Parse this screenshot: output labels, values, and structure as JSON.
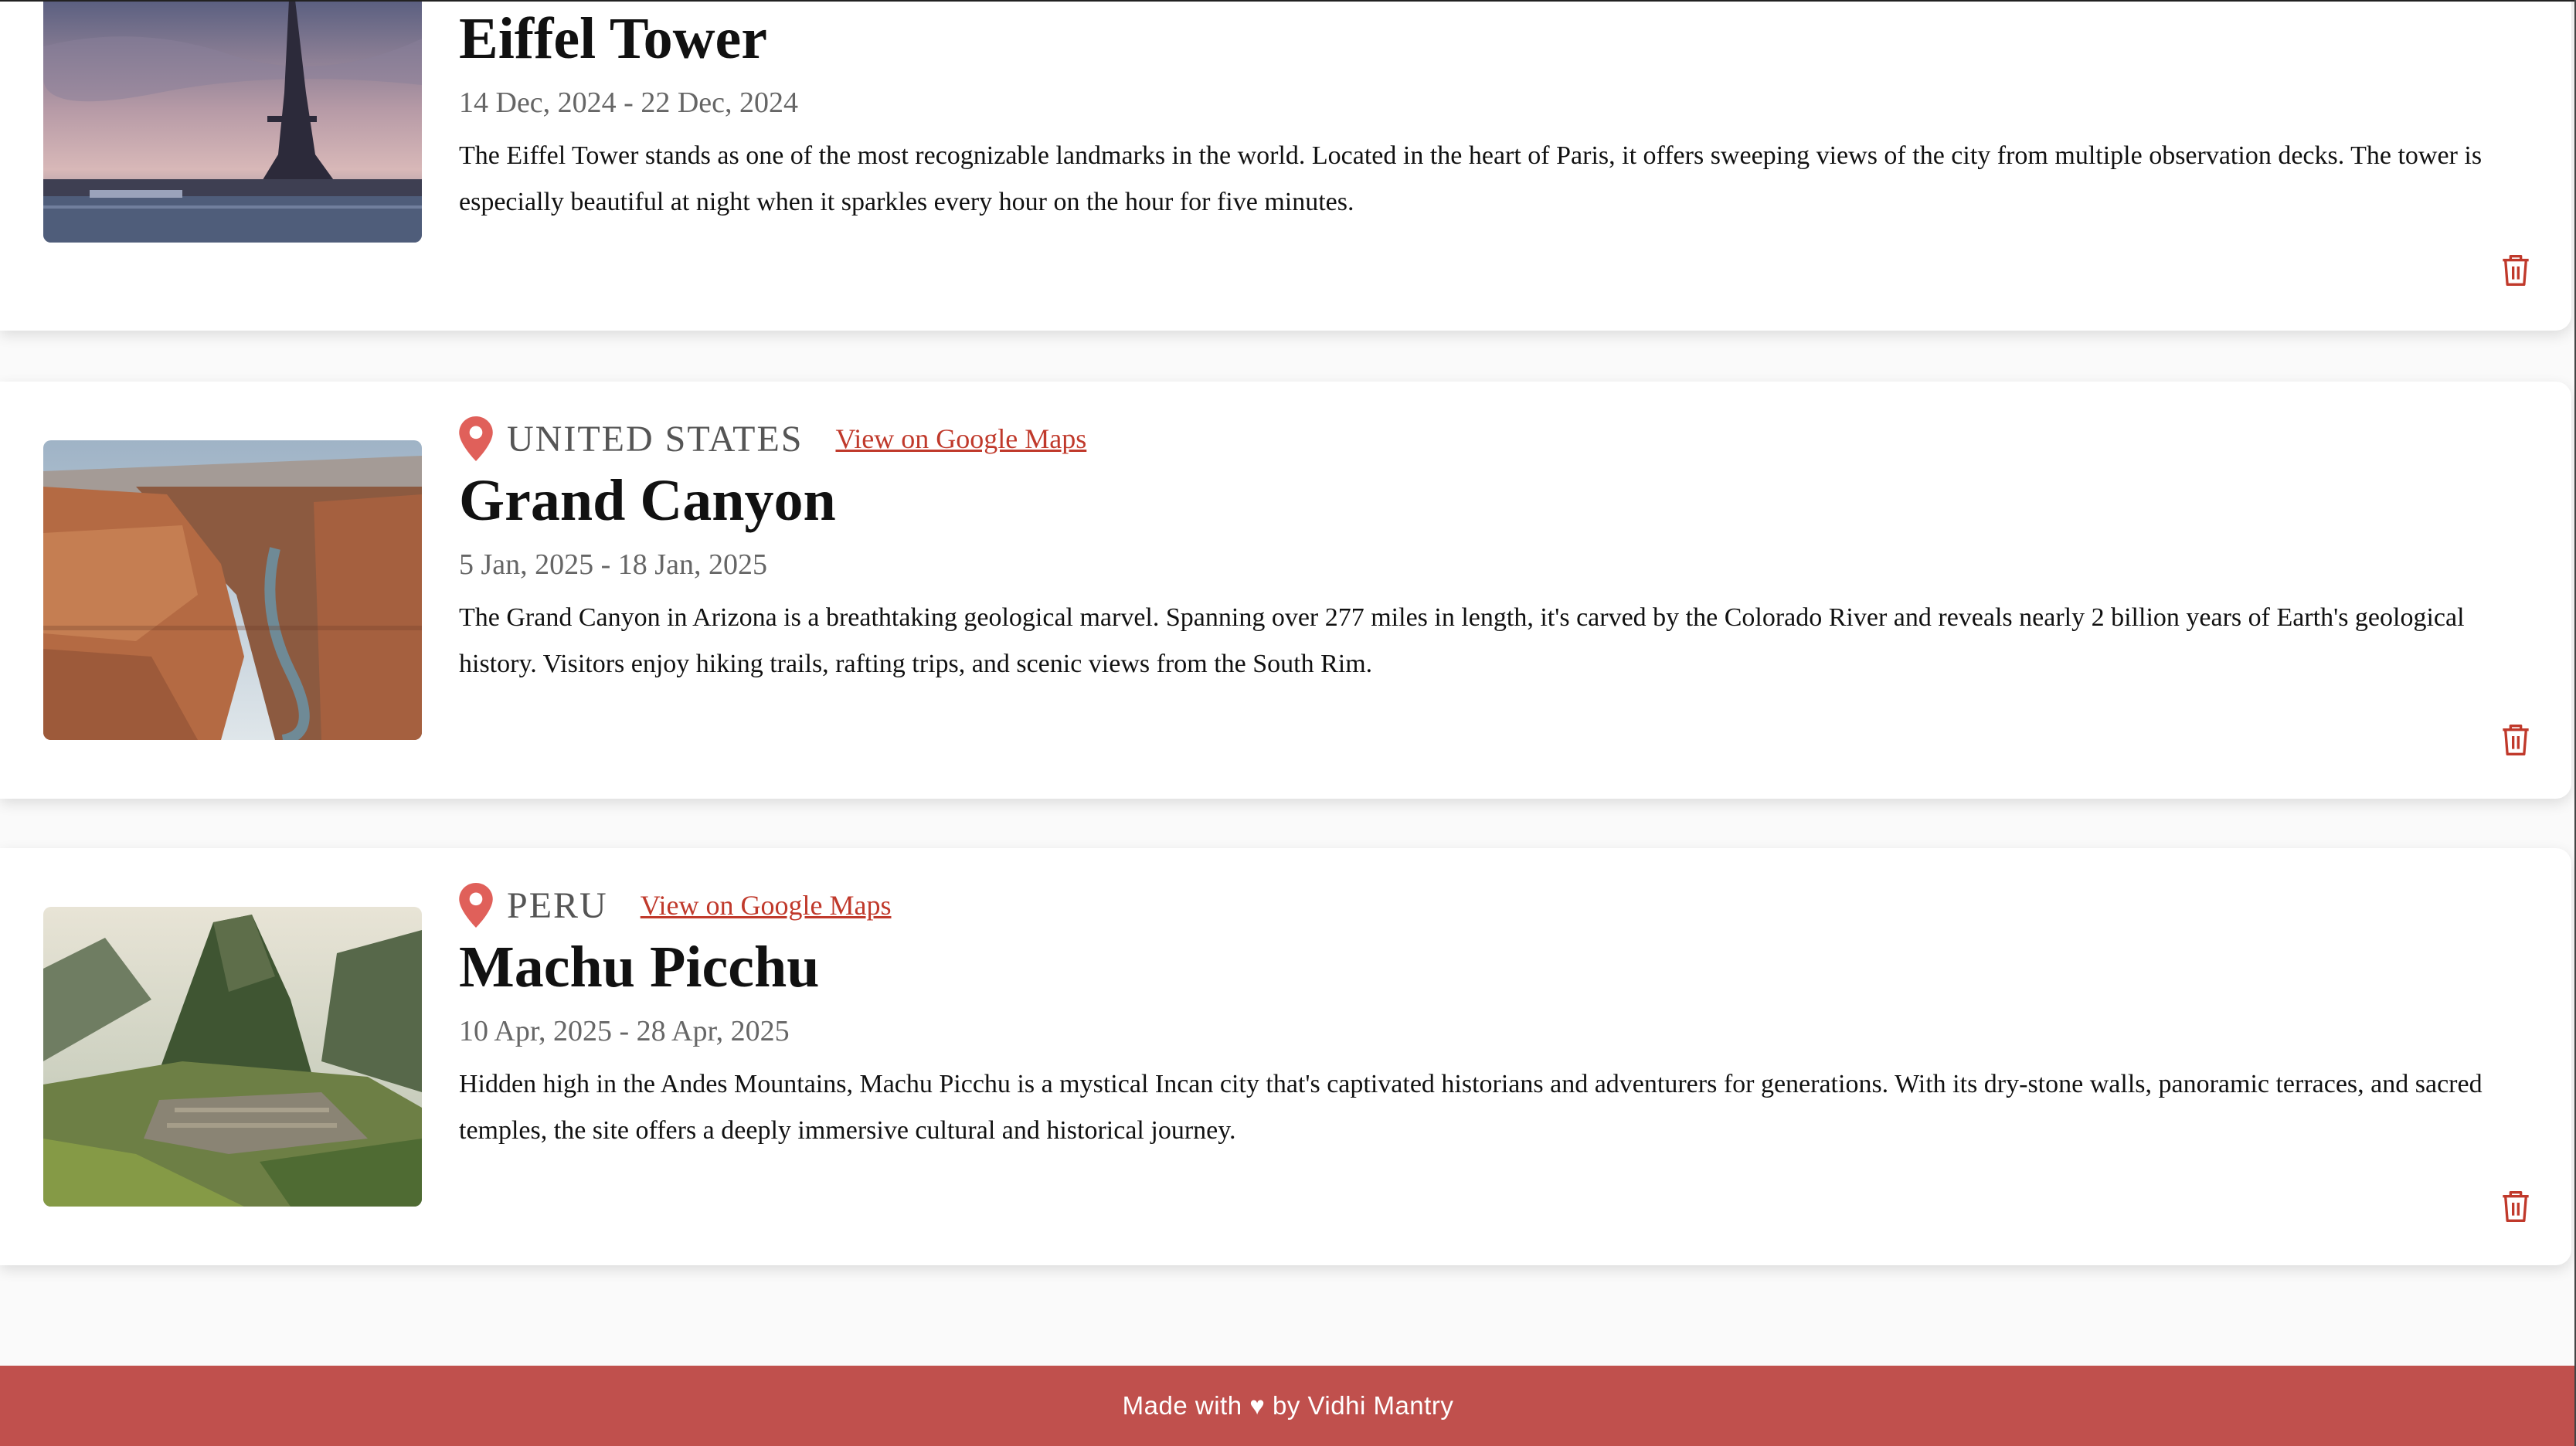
{
  "cards": [
    {
      "country": "",
      "maps_link": "",
      "title": "Eiffel Tower",
      "dates": "14 Dec, 2024 - 22 Dec, 2024",
      "description": "The Eiffel Tower stands as one of the most recognizable landmarks in the world. Located in the heart of Paris, it offers sweeping views of the city from multiple observation decks. The tower is especially beautiful at night when it sparkles every hour on the hour for five minutes.",
      "image": "eiffel-tower-photo"
    },
    {
      "country": "UNITED STATES",
      "maps_link": "View on Google Maps",
      "title": "Grand Canyon",
      "dates": "5 Jan, 2025 - 18 Jan, 2025",
      "description": "The Grand Canyon in Arizona is a breathtaking geological marvel. Spanning over 277 miles in length, it's carved by the Colorado River and reveals nearly 2 billion years of Earth's geological history. Visitors enjoy hiking trails, rafting trips, and scenic views from the South Rim.",
      "image": "grand-canyon-photo"
    },
    {
      "country": "PERU",
      "maps_link": "View on Google Maps",
      "title": "Machu Picchu",
      "dates": "10 Apr, 2025 - 28 Apr, 2025",
      "description": "Hidden high in the Andes Mountains, Machu Picchu is a mystical Incan city that's captivated historians and adventurers for generations. With its dry-stone walls, panoramic terraces, and sacred temples, the site offers a deeply immersive cultural and historical journey.",
      "image": "machu-picchu-photo"
    }
  ],
  "footer": {
    "text": "Made with ♥ by Vidhi Mantry"
  },
  "colors": {
    "accent": "#c0504d",
    "link": "#c0392b",
    "pin": "#e0605a",
    "trash": "#c0392b"
  },
  "icons": {
    "location": "map-pin-icon",
    "delete": "trash-icon"
  }
}
